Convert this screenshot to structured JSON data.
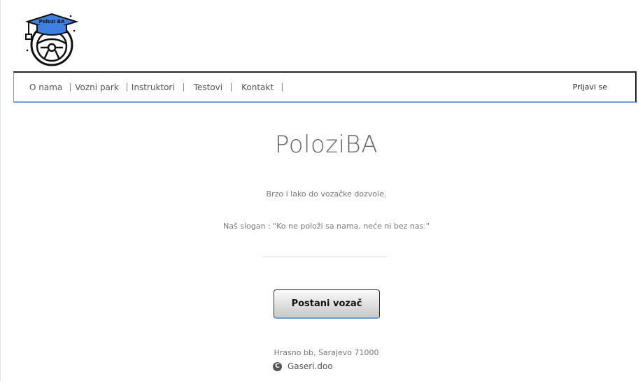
{
  "logo": {
    "text": "Polozi BA"
  },
  "nav": {
    "items": [
      {
        "label": "O nama"
      },
      {
        "label": "Vozni park"
      },
      {
        "label": "Instruktori"
      },
      {
        "label": "Testovi"
      },
      {
        "label": "Kontakt"
      }
    ],
    "login_label": "Prijavi se"
  },
  "hero": {
    "title": "PoloziBA",
    "tagline": "Brzo i lako do vozačke dozvole.",
    "slogan": "Naš slogan : \"Ko ne položi sa nama, neće ni bez nas.\""
  },
  "cta": {
    "label": "Postani vozač"
  },
  "footer": {
    "address": "Hrasno bb, Sarajevo 71000",
    "copyright_symbol": "C",
    "copyright_text": "Gaseri.doo"
  },
  "colors": {
    "accent": "#6aa0d8",
    "logo_cap": "#3f7fe0"
  },
  "icons": {
    "logo": "graduation-cap-steering-wheel-icon",
    "copyright": "copyright-icon"
  }
}
